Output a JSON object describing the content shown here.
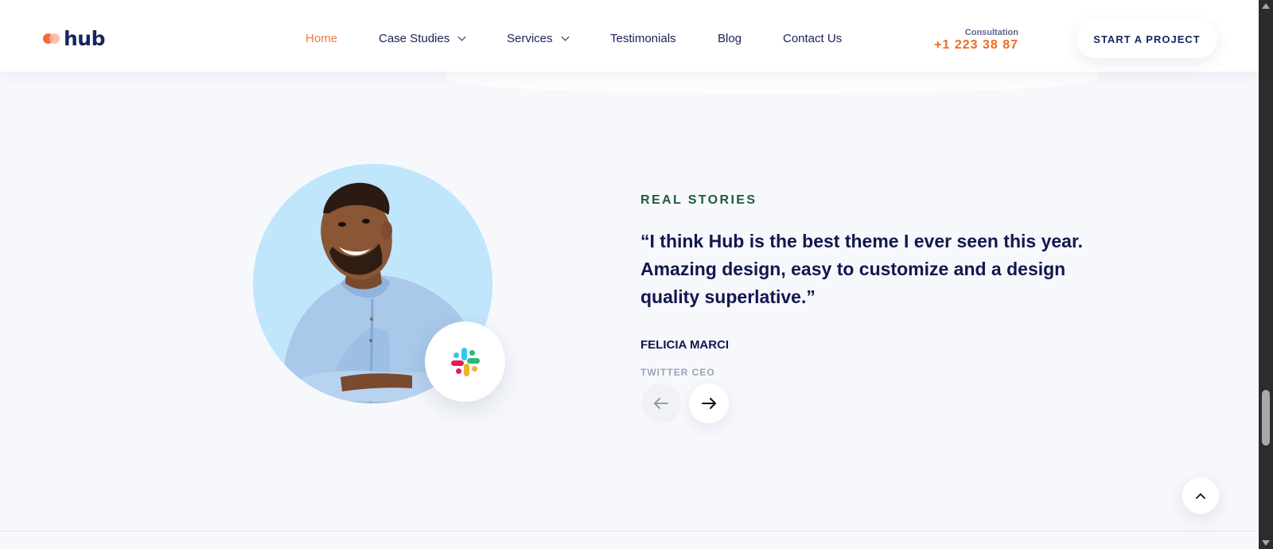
{
  "brand": {
    "name": "hub",
    "colors": {
      "accent": "#ee7a3c",
      "navy": "#16265f",
      "eyebrow": "#1f5a3b",
      "photo_bg": "#bfe6fb"
    }
  },
  "nav": {
    "items": [
      {
        "label": "Home",
        "active": true,
        "dropdown": false
      },
      {
        "label": "Case Studies",
        "active": false,
        "dropdown": true
      },
      {
        "label": "Services",
        "active": false,
        "dropdown": true
      },
      {
        "label": "Testimonials",
        "active": false,
        "dropdown": false
      },
      {
        "label": "Blog",
        "active": false,
        "dropdown": false
      },
      {
        "label": "Contact Us",
        "active": false,
        "dropdown": false
      }
    ]
  },
  "header": {
    "consultation_label": "Consultation",
    "phone": "+1 223 38 87",
    "cta_label": "START A PROJECT"
  },
  "testimonial": {
    "eyebrow": "REAL STORIES",
    "quote": "“I think Hub is the best theme I ever seen this year. Amazing design, easy to customize and a design quality superlative.”",
    "author": "FELICIA MARCI",
    "role": "TWITTER CEO",
    "badge_icon": "slack-logo-icon",
    "prev_icon": "arrow-left-icon",
    "next_icon": "arrow-right-icon"
  },
  "back_to_top_icon": "chevron-up-icon"
}
